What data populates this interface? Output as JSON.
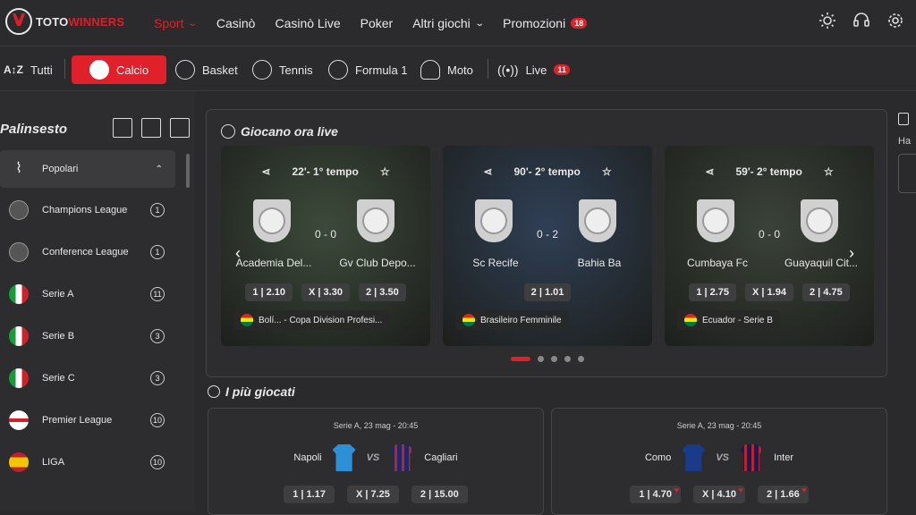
{
  "brand": {
    "part1": "TOTO",
    "part2": "WINNERS"
  },
  "nav": [
    {
      "label": "Sport",
      "chevron": true,
      "active": true
    },
    {
      "label": "Casinò"
    },
    {
      "label": "Casinò Live"
    },
    {
      "label": "Poker"
    },
    {
      "label": "Altri giochi",
      "chevron": true
    },
    {
      "label": "Promozioni",
      "badge": "18"
    }
  ],
  "sports": [
    {
      "label": "Tutti",
      "icon": "az-sort-icon"
    },
    {
      "label": "Calcio",
      "icon": "soccer-ball-icon",
      "active": true
    },
    {
      "label": "Basket",
      "icon": "basketball-icon"
    },
    {
      "label": "Tennis",
      "icon": "tennis-ball-icon"
    },
    {
      "label": "Formula 1",
      "icon": "racing-car-icon"
    },
    {
      "label": "Moto",
      "icon": "helmet-icon"
    },
    {
      "label": "Live",
      "icon": "broadcast-icon",
      "badge": "11"
    }
  ],
  "sidebar": {
    "title": "Palinsesto",
    "popular": "Popolari",
    "leagues": [
      {
        "name": "Champions League",
        "count": "1",
        "flag": "trophy"
      },
      {
        "name": "Conference League",
        "count": "1",
        "flag": "trophy"
      },
      {
        "name": "Serie A",
        "count": "11",
        "flag": "italy"
      },
      {
        "name": "Serie B",
        "count": "3",
        "flag": "italy"
      },
      {
        "name": "Serie C",
        "count": "3",
        "flag": "italy"
      },
      {
        "name": "Premier League",
        "count": "10",
        "flag": "england"
      },
      {
        "name": "LIGA",
        "count": "10",
        "flag": "spain"
      }
    ]
  },
  "live": {
    "title": "Giocano ora live",
    "cards": [
      {
        "time": "22'- 1° tempo",
        "score": "0 - 0",
        "home": "Academia Del...",
        "away": "Gv Club Depo...",
        "odds": [
          "1 | 2.10",
          "X | 3.30",
          "2 | 3.50"
        ],
        "competition": "Bolí...  -  Copa Division Profesi...",
        "bg": "#3c4a3a"
      },
      {
        "time": "90'- 2° tempo",
        "score": "0 - 2",
        "home": "Sc Recife",
        "away": "Bahia Ba",
        "odds": [
          "2 | 1.01"
        ],
        "competition": "Brasileiro Femminile",
        "bg": "#2f3f55"
      },
      {
        "time": "59'- 2° tempo",
        "score": "0 - 0",
        "home": "Cumbaya Fc",
        "away": "Guayaquil Cit...",
        "odds": [
          "1 | 2.75",
          "X | 1.94",
          "2 | 4.75"
        ],
        "competition": "Ecuador  -  Serie B",
        "bg": "#3a4238"
      }
    ]
  },
  "played": {
    "title": "I più giocati",
    "matches": [
      {
        "meta": "Serie A, 23 mag - 20:45",
        "home": "Napoli",
        "away": "Cagliari",
        "vs": "VS",
        "odds": [
          "1 | 1.17",
          "X | 7.25",
          "2 | 15.00"
        ],
        "hearts": [
          false,
          false,
          false
        ],
        "c1": "#2d8fd6",
        "c2": "#1a2a6a"
      },
      {
        "meta": "Serie A, 23 mag - 20:45",
        "home": "Como",
        "away": "Inter",
        "vs": "VS",
        "odds": [
          "1 | 4.70",
          "X | 4.10",
          "2 | 1.66"
        ],
        "hearts": [
          true,
          true,
          true
        ],
        "c1": "#1a3a8a",
        "c2": "#10205a"
      }
    ]
  },
  "right": {
    "label": "Ha"
  }
}
